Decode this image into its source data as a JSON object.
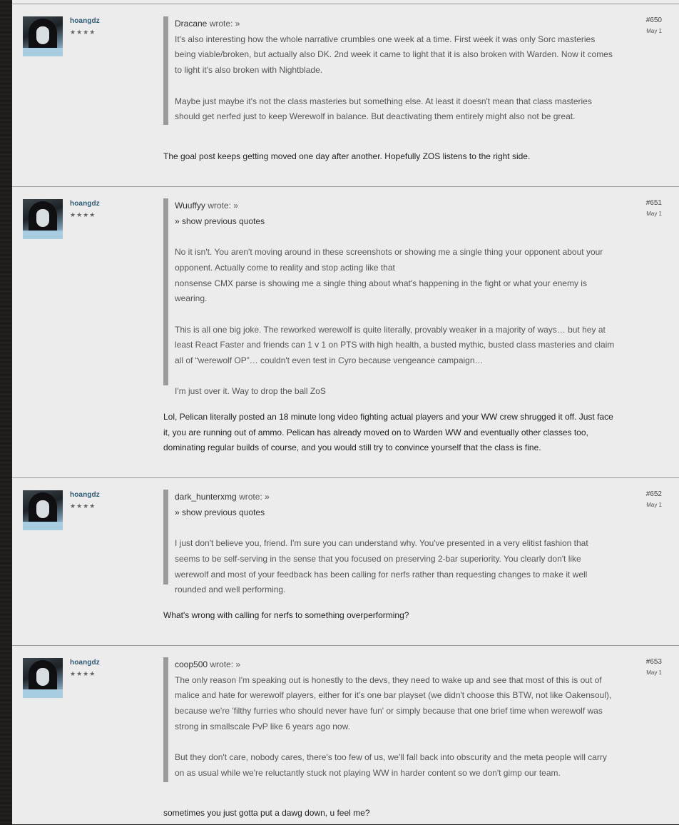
{
  "posts": [
    {
      "user": "hoangdz",
      "rank": "★★★★",
      "number": "#650",
      "date": "May 1",
      "quote_author": "Dracane",
      "wrote": "wrote: »",
      "show_previous": "",
      "quote_paragraphs": [
        "It's also interesting how the whole narrative crumbles one week at a time. First week it was only Sorc masteries being viable/broken, but actually also DK. 2nd week it came to light that it is also broken with Warden. Now it comes to light it's also broken with Nightblade.",
        "Maybe just maybe it's not the class masteries but something else. At least it doesn't mean that class masteries should get nerfed just to keep Werewolf in balance. But deactivating them entirely might also not be great."
      ],
      "reply": "The goal post keeps getting moved one day after another. Hopefully ZOS listens to the right side."
    },
    {
      "user": "hoangdz",
      "rank": "★★★★",
      "number": "#651",
      "date": "May 1",
      "quote_author": "Wuuffyy",
      "wrote": "wrote: »",
      "show_previous": "» show previous quotes",
      "quote_paragraphs": [
        "No it isn't. You aren't moving around in these screenshots or showing me a single thing your opponent about your opponent. Actually come to reality and stop acting like that\nnonsense CMX parse is showing me a single thing about what's happening in the fight or what your enemy is wearing.",
        "This is all one big joke. The reworked werewolf is quite literally, provably weaker in a majority of ways… but hey at least React Faster and friends can 1 v 1 on PTS with high health, a busted mythic, busted class masteries and claim all of “werewolf OP”… couldn't even test in Cyro because vengeance campaign…",
        "I'm just over it. Way to drop the ball ZoS"
      ],
      "reply": "Lol, Pelican literally posted an 18 minute long video fighting actual players and your WW crew shrugged it off. Just face it, you are running out of ammo. Pelican has already moved on to Warden WW and eventually other classes too, dominating regular builds of course, and you would still try to convince yourself that the class is fine."
    },
    {
      "user": "hoangdz",
      "rank": "★★★★",
      "number": "#652",
      "date": "May 1",
      "quote_author": "dark_hunterxmg",
      "wrote": "wrote: »",
      "show_previous": "» show previous quotes",
      "quote_paragraphs": [
        "I just don't believe you, friend. I'm sure you can understand why. You've presented in a very elitist fashion that seems to be self-serving in the sense that you focused on preserving 2-bar superiority. You clearly don't like werewolf and most of your feedback has been calling for nerfs rather than requesting changes to make it well rounded and well performing."
      ],
      "reply": "What's wrong with calling for nerfs to something overperforming?"
    },
    {
      "user": "hoangdz",
      "rank": "★★★★",
      "number": "#653",
      "date": "May 1",
      "quote_author": "coop500",
      "wrote": "wrote: »",
      "show_previous": "",
      "quote_paragraphs": [
        "The only reason I'm speaking out is honestly to the devs, they need to wake up and see that most of this is out of malice and hate for werewolf players, either for it's one bar playset (we didn't choose this BTW, not like Oakensoul), because we're 'filthy furries who should never have fun' or simply because that one brief time when werewolf was strong in smallscale PvP like 6 years ago now.",
        "But they don't care, nobody cares, there's too few of us, we'll fall back into obscurity and the meta people will carry on as usual while we're reluctantly stuck not playing WW in harder content so we don't gimp our team."
      ],
      "reply": "sometimes you just gotta put a dawg down, u feel me?"
    }
  ]
}
